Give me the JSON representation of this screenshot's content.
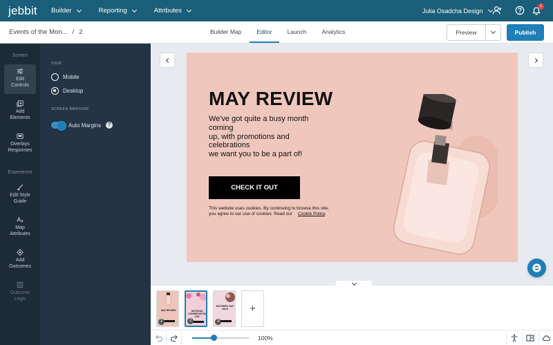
{
  "topbar": {
    "logo": "jebbit",
    "nav": [
      {
        "label": "Builder"
      },
      {
        "label": "Reporting"
      },
      {
        "label": "Attributes"
      }
    ],
    "account": "Julia Osadcha Design",
    "notification_count": "1"
  },
  "subbar": {
    "experience_name": "Events of the Mon...",
    "separator": "/",
    "screen_count": "2",
    "tabs": [
      {
        "label": "Builder Map",
        "active": false
      },
      {
        "label": "Editor",
        "active": true
      },
      {
        "label": "Launch",
        "active": false
      },
      {
        "label": "Analytics",
        "active": false
      }
    ],
    "preview_label": "Preview",
    "publish_label": "Publish"
  },
  "rail": {
    "screen_heading": "Screen",
    "experience_heading": "Experience",
    "items": [
      {
        "label_1": "Edit",
        "label_2": "Controls",
        "icon": "sliders-icon"
      },
      {
        "label_1": "Add",
        "label_2": "Elements",
        "icon": "add-element-icon"
      },
      {
        "label_1": "Overlays",
        "label_2": "Responses",
        "icon": "overlay-icon"
      },
      {
        "label_1": "Edit Style",
        "label_2": "Guide",
        "icon": "brush-icon"
      },
      {
        "label_1": "Map",
        "label_2": "Attributes",
        "icon": "map-attributes-icon"
      },
      {
        "label_1": "Add",
        "label_2": "Outcomes",
        "icon": "outcome-icon"
      },
      {
        "label_1": "Outcome",
        "label_2": "Logic",
        "icon": "logic-icon"
      }
    ]
  },
  "panel": {
    "view_heading": "VIEW",
    "view_options": [
      {
        "label": "Mobile",
        "selected": false
      },
      {
        "label": "Desktop",
        "selected": true
      }
    ],
    "margins_heading": "SCREEN MARGINS",
    "auto_margins_label": "Auto Margins",
    "auto_margins_on": true,
    "help_glyph": "?"
  },
  "stage": {
    "background": "#f0c7bd",
    "headline": "MAY REVIEW",
    "body_lines": [
      "We've got quite a busy month",
      "coming",
      "up, with promotions and",
      "celebrations",
      "we want you to be a part of!"
    ],
    "cta_label": "CHECK IT OUT",
    "cookie_text_1": "This website uses cookies. By continuing to browse this site,",
    "cookie_text_2": "you agree to our use of cookies. Read our",
    "cookie_link": "Cookie Policy",
    "cookie_end": "."
  },
  "thumbnails": [
    {
      "num": "1",
      "title": "MAY REVIEW",
      "bg": "#efc5bb",
      "selected": false
    },
    {
      "num": "2",
      "title": "NATIONAL CONSERVATION DAY",
      "bg": "#f1cfd9",
      "selected": true
    },
    {
      "num": "3",
      "title": "MOTHERS' DAY SALE",
      "bg": "#efd8df",
      "selected": false
    }
  ],
  "add_screen_glyph": "+",
  "zoom": {
    "label": "100%",
    "level": 0.38
  },
  "colors": {
    "accent": "#1f7fb6",
    "topbar": "#1a5e7a",
    "rail": "#1d2a38",
    "panel": "#243444"
  }
}
